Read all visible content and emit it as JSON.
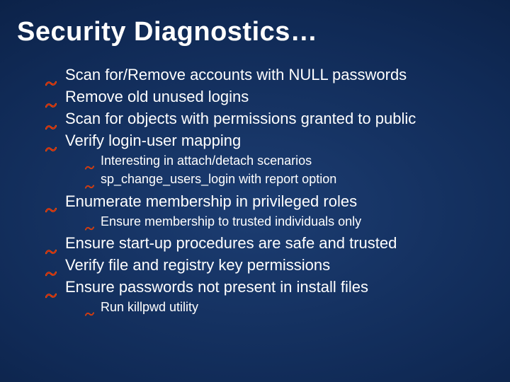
{
  "title": "Security Diagnostics…",
  "items": [
    {
      "text": "Scan for/Remove accounts with NULL passwords"
    },
    {
      "text": "Remove old unused logins"
    },
    {
      "text": "Scan for objects with permissions granted to public"
    },
    {
      "text": "Verify login-user mapping",
      "children": [
        {
          "text": "Interesting in attach/detach scenarios"
        },
        {
          "text": "sp_change_users_login with report option"
        }
      ]
    },
    {
      "text": "Enumerate membership in privileged roles",
      "children": [
        {
          "text": "Ensure membership to trusted individuals only"
        }
      ]
    },
    {
      "text": "Ensure start-up procedures are safe and trusted"
    },
    {
      "text": "Verify file and registry key permissions"
    },
    {
      "text": "Ensure passwords not present in install files",
      "children": [
        {
          "text": "Run killpwd utility"
        }
      ]
    }
  ]
}
